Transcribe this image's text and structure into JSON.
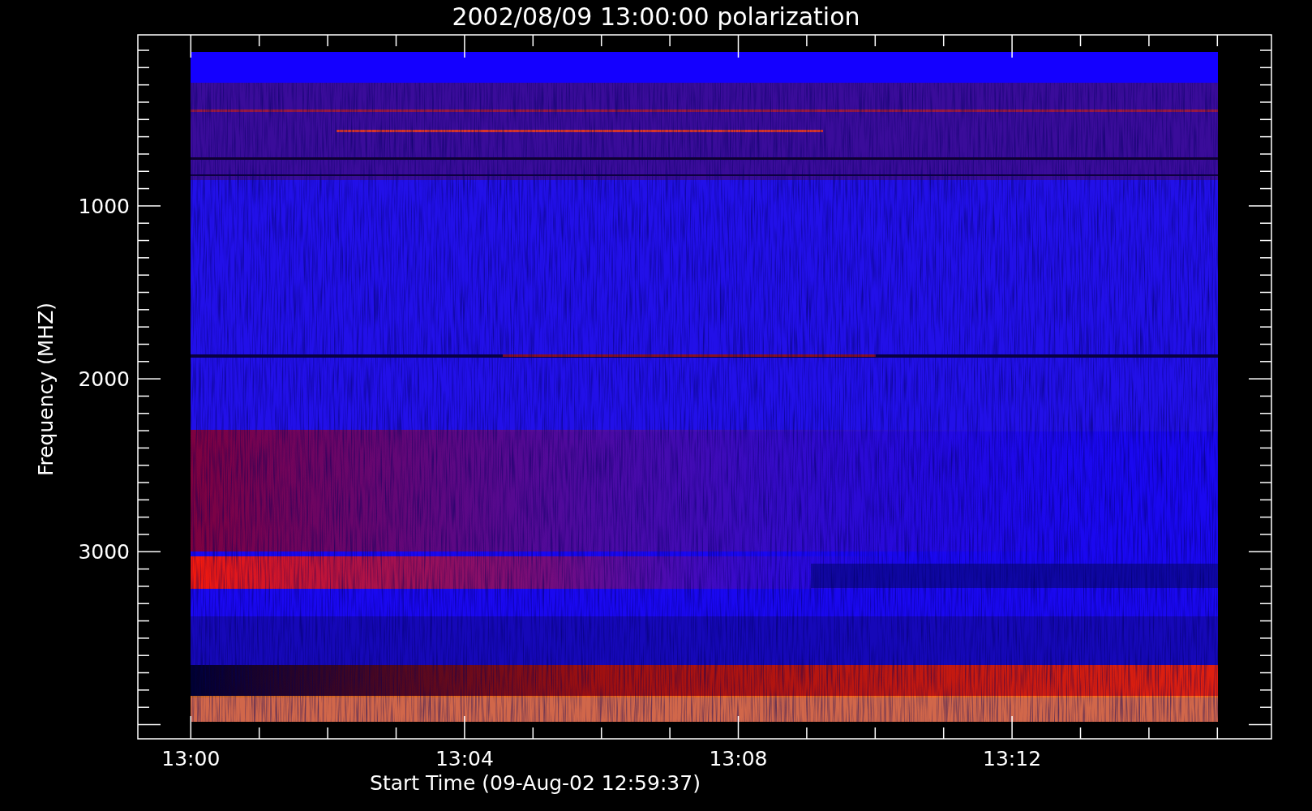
{
  "title": "2002/08/09 13:00:00 polarization",
  "y_axis": {
    "label": "Frequency (MHZ)",
    "ticks": [
      "1000",
      "2000",
      "3000"
    ]
  },
  "x_axis": {
    "label": "Start Time (09-Aug-02 12:59:37)",
    "ticks": [
      "13:00",
      "13:04",
      "13:08",
      "13:12"
    ]
  }
}
